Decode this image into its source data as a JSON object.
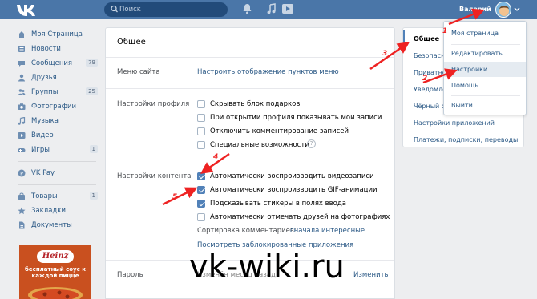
{
  "header": {
    "logo": "VK",
    "search_placeholder": "Поиск",
    "user_name": "Валерий",
    "icons": [
      "vk-logo-icon",
      "search-icon",
      "bell-icon",
      "music-icon",
      "play-icon",
      "chevron-down-icon"
    ]
  },
  "sidebar": {
    "items": [
      {
        "label": "Моя Страница",
        "icon": "home-icon"
      },
      {
        "label": "Новости",
        "icon": "news-icon"
      },
      {
        "label": "Сообщения",
        "icon": "chat-icon",
        "badge": "79"
      },
      {
        "label": "Друзья",
        "icon": "user-icon"
      },
      {
        "label": "Группы",
        "icon": "group-icon",
        "badge": "25"
      },
      {
        "label": "Фотографии",
        "icon": "camera-icon"
      },
      {
        "label": "Музыка",
        "icon": "music-icon"
      },
      {
        "label": "Видео",
        "icon": "video-icon"
      },
      {
        "label": "Игры",
        "icon": "gamepad-icon",
        "badge": "1"
      }
    ],
    "pay": {
      "label": "VK Pay",
      "icon": "vkpay-icon"
    },
    "extra": [
      {
        "label": "Товары",
        "icon": "bag-icon",
        "badge": "1"
      },
      {
        "label": "Закладки",
        "icon": "star-icon"
      },
      {
        "label": "Документы",
        "icon": "doc-icon"
      }
    ],
    "ad": {
      "brand": "Heinz",
      "text": "бесплатный соус к каждой пицце"
    }
  },
  "main": {
    "title": "Общее",
    "menu_label": "Меню сайта",
    "menu_link": "Настроить отображение пунктов меню",
    "profile_label": "Настройки профиля",
    "profile_options": [
      {
        "label": "Скрывать блок подарков",
        "checked": false
      },
      {
        "label": "При открытии профиля показывать мои записи",
        "checked": false
      },
      {
        "label": "Отключить комментирование записей",
        "checked": false
      },
      {
        "label": "Специальные возможности",
        "checked": false
      }
    ],
    "help_mark": "?",
    "content_label": "Настройки контента",
    "content_options": [
      {
        "label": "Автоматически воспроизводить видеозаписи",
        "checked": true
      },
      {
        "label": "Автоматически воспроизводить GIF-анимации",
        "checked": true
      },
      {
        "label": "Подсказывать стикеры в полях ввода",
        "checked": true
      },
      {
        "label": "Автоматически отмечать друзей на фотографиях",
        "checked": false
      }
    ],
    "sort_label": "Сортировка комментариев:",
    "sort_value": "сначала интересные",
    "blocked_apps_link": "Посмотреть заблокированные приложения",
    "password_label": "Пароль",
    "password_status": "Изменён месяц назад",
    "password_change": "Изменить"
  },
  "right_menu": {
    "items": [
      {
        "label": "Общее",
        "active": true
      },
      {
        "label": "Безопасность"
      },
      {
        "label": "Приватность"
      },
      {
        "label": "Уведомления"
      },
      {
        "label": "Чёрный список"
      },
      {
        "label": "Настройки приложений"
      },
      {
        "label": "Платежи, подписки, переводы"
      }
    ]
  },
  "dropdown": {
    "items": [
      {
        "label": "Моя страница"
      },
      {
        "label": "Редактировать"
      },
      {
        "label": "Настройки",
        "highlighted": true
      },
      {
        "label": "Помощь"
      },
      {
        "label": "Выйти"
      }
    ]
  },
  "annotations": {
    "watermark": "vk-wiki.ru",
    "numbers": [
      "1",
      "2",
      "3",
      "4",
      "5"
    ],
    "color": "#e02222"
  },
  "colors": {
    "header": "#4a76a8",
    "link": "#2a5885",
    "background": "#edeef0",
    "checkbox": "#5181b8"
  }
}
